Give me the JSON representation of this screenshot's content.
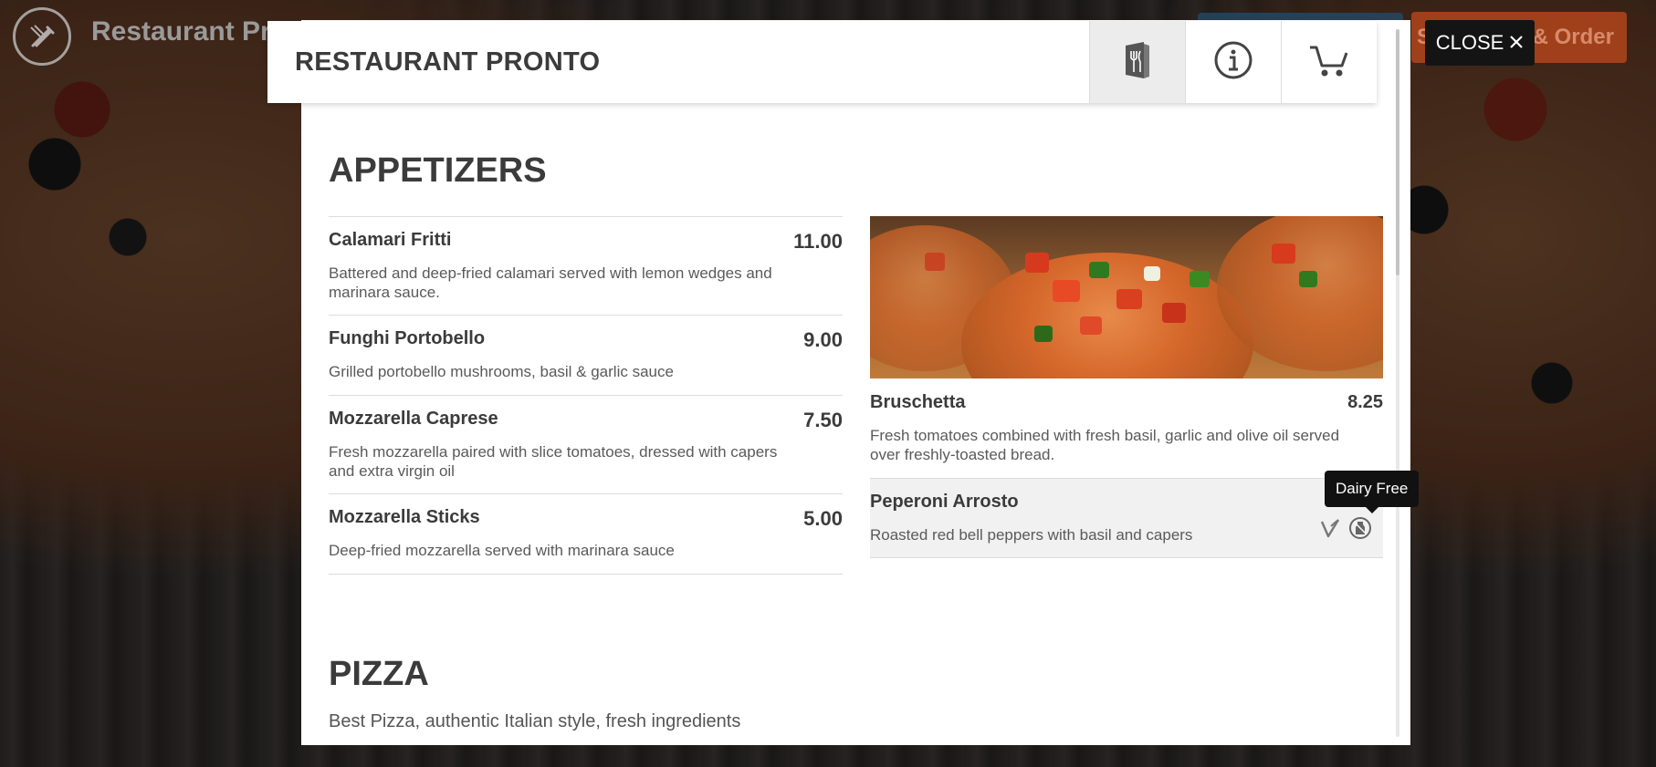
{
  "site": {
    "title": "Restaurant Pr",
    "order_button": "See MENU & Order"
  },
  "modal": {
    "title": "RESTAURANT PRONTO",
    "tabs": [
      {
        "icon": "menu-icon",
        "active": true
      },
      {
        "icon": "info-icon",
        "active": false
      },
      {
        "icon": "cart-icon",
        "active": false
      }
    ],
    "close_label": "CLOSE"
  },
  "sections": [
    {
      "title": "APPETIZERS",
      "items_left": [
        {
          "name": "Calamari Fritti",
          "price": "11.00",
          "desc": "Battered and deep-fried calamari served with lemon wedges and marinara sauce."
        },
        {
          "name": "Funghi Portobello",
          "price": "9.00",
          "desc": "Grilled portobello mushrooms, basil & garlic sauce"
        },
        {
          "name": "Mozzarella Caprese",
          "price": "7.50",
          "desc": "Fresh mozzarella paired with slice tomatoes, dressed with capers and extra virgin oil"
        },
        {
          "name": "Mozzarella Sticks",
          "price": "5.00",
          "desc": "Deep-fried mozzarella served with marinara sauce"
        }
      ],
      "items_right": [
        {
          "name": "Bruschetta",
          "price": "8.25",
          "desc": "Fresh tomatoes combined with fresh basil, garlic and olive oil served over freshly-toasted bread.",
          "has_photo": true
        },
        {
          "name": "Peperoni Arrosto",
          "price": "",
          "desc": "Roasted red bell peppers with basil and capers",
          "diet_icons": [
            "vegan-icon",
            "dairy-free-icon"
          ]
        }
      ]
    },
    {
      "title": "PIZZA",
      "desc": "Best Pizza, authentic Italian style, fresh ingredients"
    }
  ],
  "tooltip": {
    "text": "Dairy Free"
  }
}
